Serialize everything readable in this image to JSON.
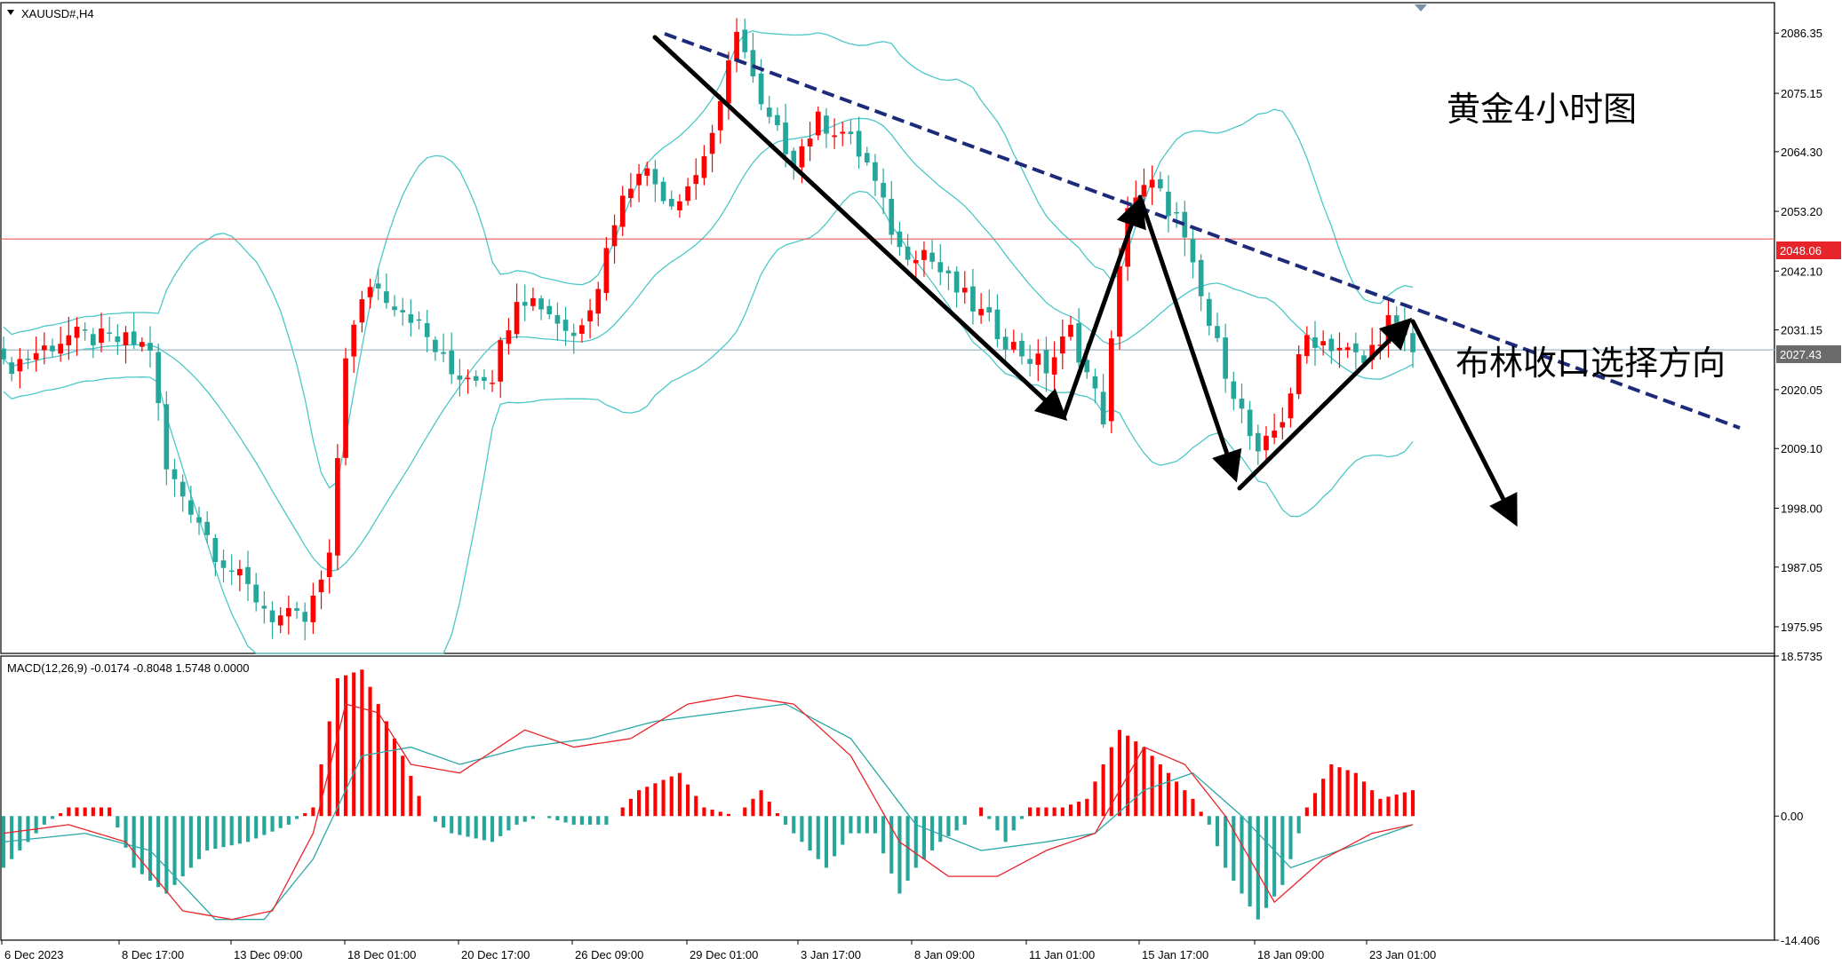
{
  "symbol_label": "XAUUSD#,H4",
  "annotation_title": "黄金4小时图",
  "annotation_sub": "布林收口选择方向",
  "macd_label": "MACD(12,26,9) -0.0174 -0.8048 1.5748 0.0000",
  "price_badges": [
    {
      "label": "2048.06",
      "value": 2048.06,
      "color": "#e8242b",
      "line_color": "#f05a5a"
    },
    {
      "label": "2027.43",
      "value": 2027.43,
      "color": "#6b6b6b",
      "line_color": "#9eb8c8"
    }
  ],
  "colors": {
    "bull": "#ff0000",
    "bear": "#26a69a",
    "band": "#4cc7c7",
    "trend": "#1d2a7a",
    "macd_line": "#e8242b",
    "signal_line": "#2aa8a8"
  },
  "chart_data": [
    {
      "type": "candlestick",
      "title": "XAUUSD#,H4",
      "ylim": [
        1971,
        2092
      ],
      "y_ticks": [
        "2086.35",
        "2075.15",
        "2064.30",
        "2053.20",
        "2042.10",
        "2031.15",
        "2020.05",
        "2009.10",
        "1998.00",
        "1987.05",
        "1975.95"
      ],
      "x_ticks": [
        "6 Dec 2023",
        "8 Dec 17:00",
        "13 Dec 09:00",
        "18 Dec 01:00",
        "20 Dec 17:00",
        "26 Dec 09:00",
        "29 Dec 01:00",
        "3 Jan 17:00",
        "8 Jan 09:00",
        "11 Jan 01:00",
        "15 Jan 17:00",
        "18 Jan 09:00",
        "23 Jan 01:00"
      ],
      "close_anchors": [
        [
          0,
          2024
        ],
        [
          8,
          2030
        ],
        [
          15,
          2029
        ],
        [
          18,
          2028
        ],
        [
          20,
          2005
        ],
        [
          24,
          1996
        ],
        [
          26,
          1990
        ],
        [
          30,
          1983
        ],
        [
          33,
          1978
        ],
        [
          37,
          1977
        ],
        [
          40,
          1988
        ],
        [
          42,
          2027
        ],
        [
          45,
          2040
        ],
        [
          50,
          2034
        ],
        [
          55,
          2023
        ],
        [
          60,
          2023
        ],
        [
          63,
          2038
        ],
        [
          66,
          2036
        ],
        [
          70,
          2030
        ],
        [
          73,
          2040
        ],
        [
          75,
          2052
        ],
        [
          78,
          2062
        ],
        [
          82,
          2055
        ],
        [
          85,
          2060
        ],
        [
          88,
          2072
        ],
        [
          90,
          2088
        ],
        [
          93,
          2072
        ],
        [
          97,
          2063
        ],
        [
          100,
          2070
        ],
        [
          103,
          2068
        ],
        [
          106,
          2062
        ],
        [
          110,
          2046
        ],
        [
          113,
          2046
        ],
        [
          116,
          2040
        ],
        [
          120,
          2034
        ],
        [
          124,
          2028
        ],
        [
          128,
          2024
        ],
        [
          131,
          2031
        ],
        [
          135,
          2015
        ],
        [
          138,
          2055
        ],
        [
          141,
          2058
        ],
        [
          144,
          2052
        ],
        [
          148,
          2032
        ],
        [
          151,
          2020
        ],
        [
          154,
          2007
        ],
        [
          157,
          2015
        ],
        [
          160,
          2030
        ],
        [
          164,
          2028
        ],
        [
          167,
          2025
        ],
        [
          170,
          2033
        ],
        [
          173,
          2027
        ]
      ],
      "reference_lines": [
        2048.06,
        2027.43
      ]
    },
    {
      "type": "macd",
      "title": "MACD(12,26,9) -0.0174 -0.8048 1.5748 0.0000",
      "ylim": [
        -14.406,
        18.5735
      ],
      "y_ticks": [
        "18.5735",
        "0.00",
        "-14.406"
      ],
      "histogram_anchors": [
        [
          0,
          -6
        ],
        [
          5,
          -1
        ],
        [
          8,
          1
        ],
        [
          13,
          1
        ],
        [
          16,
          -6
        ],
        [
          20,
          -9
        ],
        [
          25,
          -4
        ],
        [
          30,
          -3
        ],
        [
          35,
          -1
        ],
        [
          38,
          1
        ],
        [
          41,
          16
        ],
        [
          44,
          17
        ],
        [
          49,
          7
        ],
        [
          52,
          0
        ],
        [
          55,
          -2
        ],
        [
          60,
          -3
        ],
        [
          63,
          -1
        ],
        [
          66,
          0
        ],
        [
          70,
          -1
        ],
        [
          74,
          -1
        ],
        [
          78,
          3
        ],
        [
          83,
          5
        ],
        [
          86,
          1
        ],
        [
          90,
          0
        ],
        [
          93,
          3
        ],
        [
          96,
          -1
        ],
        [
          99,
          -4
        ],
        [
          101,
          -6
        ],
        [
          104,
          -2
        ],
        [
          107,
          -2
        ],
        [
          110,
          -9
        ],
        [
          112,
          -6
        ],
        [
          115,
          -3
        ],
        [
          118,
          -1
        ],
        [
          120,
          1
        ],
        [
          123,
          -3
        ],
        [
          126,
          1
        ],
        [
          130,
          1
        ],
        [
          133,
          2
        ],
        [
          137,
          10
        ],
        [
          140,
          8
        ],
        [
          144,
          4
        ],
        [
          146,
          2
        ],
        [
          148,
          -1
        ],
        [
          150,
          -6
        ],
        [
          154,
          -12
        ],
        [
          157,
          -8
        ],
        [
          160,
          1
        ],
        [
          163,
          6
        ],
        [
          166,
          5
        ],
        [
          169,
          2
        ],
        [
          173,
          3
        ]
      ],
      "macd_anchors": [
        [
          0,
          -2
        ],
        [
          8,
          -1
        ],
        [
          15,
          -3
        ],
        [
          22,
          -11
        ],
        [
          28,
          -12
        ],
        [
          33,
          -11
        ],
        [
          38,
          -2
        ],
        [
          42,
          13
        ],
        [
          46,
          12
        ],
        [
          50,
          6
        ],
        [
          56,
          5
        ],
        [
          64,
          10
        ],
        [
          70,
          8
        ],
        [
          77,
          9
        ],
        [
          84,
          13
        ],
        [
          90,
          14
        ],
        [
          97,
          13
        ],
        [
          104,
          7
        ],
        [
          110,
          -3
        ],
        [
          116,
          -7
        ],
        [
          122,
          -7
        ],
        [
          128,
          -4
        ],
        [
          134,
          -2
        ],
        [
          140,
          8
        ],
        [
          145,
          6
        ],
        [
          150,
          0
        ],
        [
          156,
          -10
        ],
        [
          162,
          -5
        ],
        [
          168,
          -2
        ],
        [
          173,
          -1
        ]
      ],
      "signal_anchors": [
        [
          0,
          -3
        ],
        [
          10,
          -2
        ],
        [
          18,
          -4
        ],
        [
          26,
          -12
        ],
        [
          32,
          -12
        ],
        [
          38,
          -5
        ],
        [
          44,
          7
        ],
        [
          50,
          8
        ],
        [
          56,
          6
        ],
        [
          64,
          8
        ],
        [
          72,
          9
        ],
        [
          80,
          11
        ],
        [
          88,
          12
        ],
        [
          96,
          13
        ],
        [
          104,
          9
        ],
        [
          112,
          -1
        ],
        [
          120,
          -4
        ],
        [
          128,
          -3
        ],
        [
          134,
          -2
        ],
        [
          140,
          3
        ],
        [
          146,
          5
        ],
        [
          152,
          0
        ],
        [
          158,
          -6
        ],
        [
          164,
          -4
        ],
        [
          170,
          -2
        ],
        [
          173,
          -1
        ]
      ]
    }
  ]
}
